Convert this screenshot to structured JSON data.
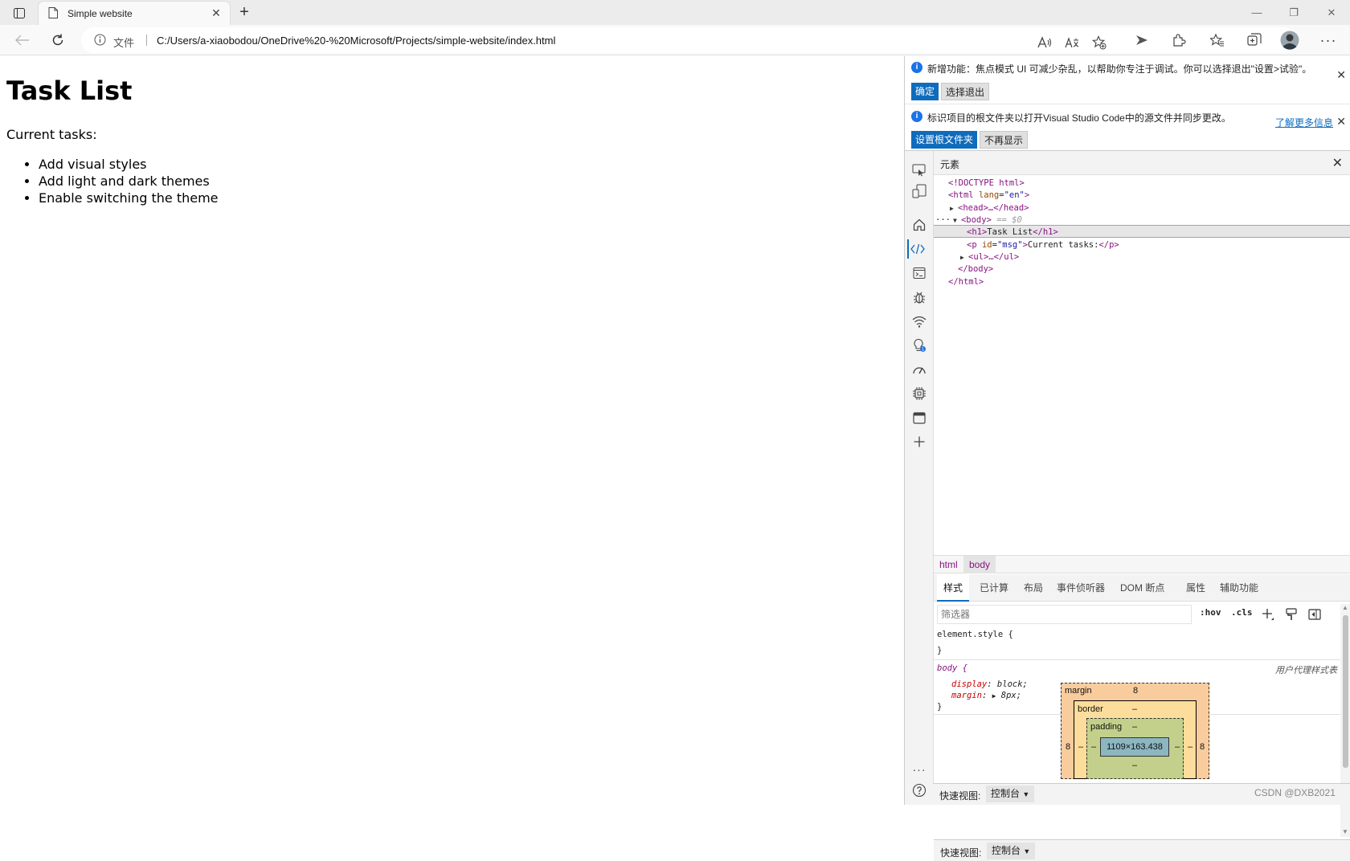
{
  "browser": {
    "tab_title": "Simple website",
    "address_label": "文件",
    "url": "C:/Users/a-xiaobodou/OneDrive%20-%20Microsoft/Projects/simple-website/index.html"
  },
  "page": {
    "heading": "Task List",
    "message": "Current tasks:",
    "tasks": [
      "Add visual styles",
      "Add light and dark themes",
      "Enable switching the theme"
    ]
  },
  "devtools": {
    "infobar1": {
      "text": "新增功能：焦点模式 UI 可减少杂乱，以帮助你专注于调试。你可以选择退出\"设置>试验\"。",
      "ok": "确定",
      "opt_out": "选择退出"
    },
    "infobar2": {
      "text": "标识项目的根文件夹以打开Visual Studio Code中的源文件并同步更改。",
      "learn_more": "了解更多信息",
      "set_root": "设置根文件夹",
      "dont_show": "不再显示"
    },
    "panel_title": "元素",
    "dom": {
      "doctype": "<!DOCTYPE html>",
      "html_open": "<html",
      "lang_attr": "lang",
      "lang_val": "\"en\"",
      "head": "<head>…</head>",
      "body_open": "<body>",
      "body_eq": "== $0",
      "h1_open": "<h1>",
      "h1_text": "Task List",
      "h1_close": "</h1>",
      "p_open": "<p",
      "id_attr": "id",
      "id_val": "\"msg\"",
      "p_text": "Current tasks:",
      "p_close": "</p>",
      "ul": "<ul>…</ul>",
      "body_close": "</body>",
      "html_close": "</html>",
      "ellipsis": "···"
    },
    "breadcrumbs": [
      "html",
      "body"
    ],
    "subtabs": [
      "样式",
      "已计算",
      "布局",
      "事件侦听器",
      "DOM 断点",
      "属性",
      "辅助功能"
    ],
    "filter_placeholder": "筛选器",
    "hov": ":hov",
    "cls": ".cls",
    "styles": {
      "element_style": "element.style {",
      "close_brace": "}",
      "body_selector": "body {",
      "origin": "用户代理样式表",
      "display_prop": "display",
      "display_val": "block;",
      "margin_prop": "margin",
      "margin_val": "8px;"
    },
    "box_model": {
      "margin_label": "margin",
      "margin_top": "8",
      "margin_left": "8",
      "margin_right": "8",
      "border_label": "border",
      "border_val": "–",
      "padding_label": "padding",
      "padding_val": "–",
      "content": "1109×163.438",
      "dash": "–"
    },
    "drawer_label": "快速视图:",
    "drawer_tab": "控制台"
  },
  "watermark": "CSDN @DXB2021",
  "colors": {
    "accent": "#0f6cbd",
    "tag": "#881280",
    "attr": "#994500",
    "value": "#1a1aa6"
  }
}
